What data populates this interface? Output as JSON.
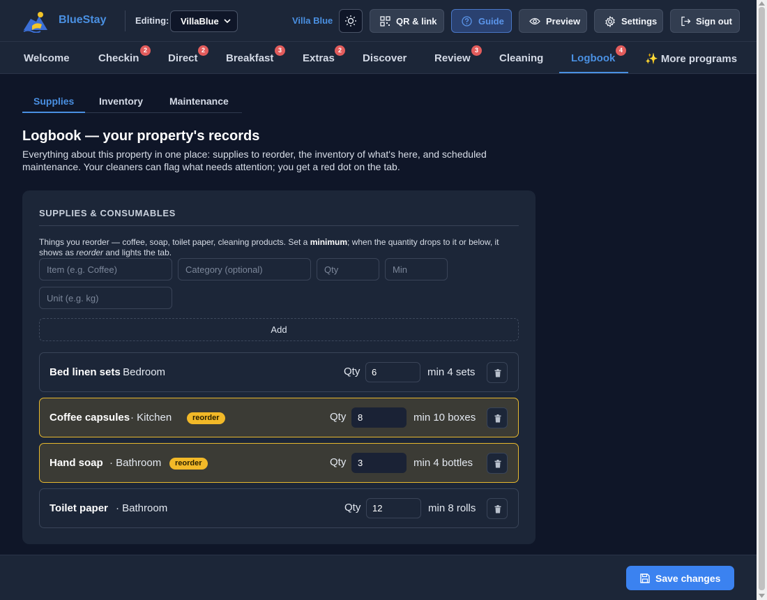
{
  "header": {
    "brand": "BlueStay",
    "editing_label": "Editing:",
    "property_select": "VillaBlue",
    "property_name": "Villa Blue",
    "buttons": {
      "qr": "QR & link",
      "guide": "Guide",
      "preview": "Preview",
      "settings": "Settings",
      "signout": "Sign out"
    },
    "icons": [
      "logo-icon",
      "chevron-down-icon",
      "sun-icon",
      "qr-icon",
      "help-icon",
      "eye-icon",
      "gear-icon",
      "sign-out-icon"
    ]
  },
  "nav": {
    "tabs": [
      {
        "label": "Welcome",
        "badge": ""
      },
      {
        "label": "Checkin",
        "badge": "2"
      },
      {
        "label": "Direct",
        "badge": "2"
      },
      {
        "label": "Breakfast",
        "badge": "3"
      },
      {
        "label": "Extras",
        "badge": "2"
      },
      {
        "label": "Discover",
        "badge": ""
      },
      {
        "label": "Review",
        "badge": "3"
      },
      {
        "label": "Cleaning",
        "badge": ""
      },
      {
        "label": "Logbook",
        "badge": "4"
      },
      {
        "label": "✨ More programs",
        "badge": ""
      }
    ],
    "active": "Logbook"
  },
  "subtabs": {
    "items": [
      "Supplies",
      "Inventory",
      "Maintenance"
    ],
    "active": "Supplies"
  },
  "page": {
    "title": "Logbook — your property's records",
    "description": "Everything about this property in one place: supplies to reorder, the inventory of what's here, and scheduled maintenance. Your cleaners can flag what needs attention; you get a red dot on the tab."
  },
  "supplies": {
    "section_title": "SUPPLIES & CONSUMABLES",
    "help": {
      "part1": "Things you reorder — coffee, soap, toilet paper, cleaning products. Set a ",
      "bold": "minimum",
      "part2": "; when the quantity drops to it or below, it shows as ",
      "italic": "reorder",
      "part3": " and lights the tab."
    },
    "form": {
      "item_placeholder": "Item (e.g. Coffee)",
      "category_placeholder": "Category (optional)",
      "qty_placeholder": "Qty",
      "min_placeholder": "Min",
      "unit_placeholder": "Unit (e.g. kg)",
      "add_label": "Add"
    },
    "qty_label": "Qty",
    "reorder_label": "reorder",
    "items": [
      {
        "name": "Bed linen sets",
        "category": "· Bedroom",
        "qty": "6",
        "min": "min 4 sets",
        "reorder": false
      },
      {
        "name": "Coffee capsules",
        "category": "· Kitchen",
        "qty": "8",
        "min": "min 10 boxes",
        "reorder": true
      },
      {
        "name": "Hand soap",
        "category": "· Bathroom",
        "qty": "3",
        "min": "min 4 bottles",
        "reorder": true
      },
      {
        "name": "Toilet paper",
        "category": "· Bathroom",
        "qty": "12",
        "min": "min 8 rolls",
        "reorder": false
      }
    ]
  },
  "footer": {
    "save_label": "Save changes"
  },
  "colors": {
    "accent": "#4a90e2",
    "badge": "#e25c5c",
    "reorder": "#f2b928",
    "primary_button": "#3b82f0"
  }
}
